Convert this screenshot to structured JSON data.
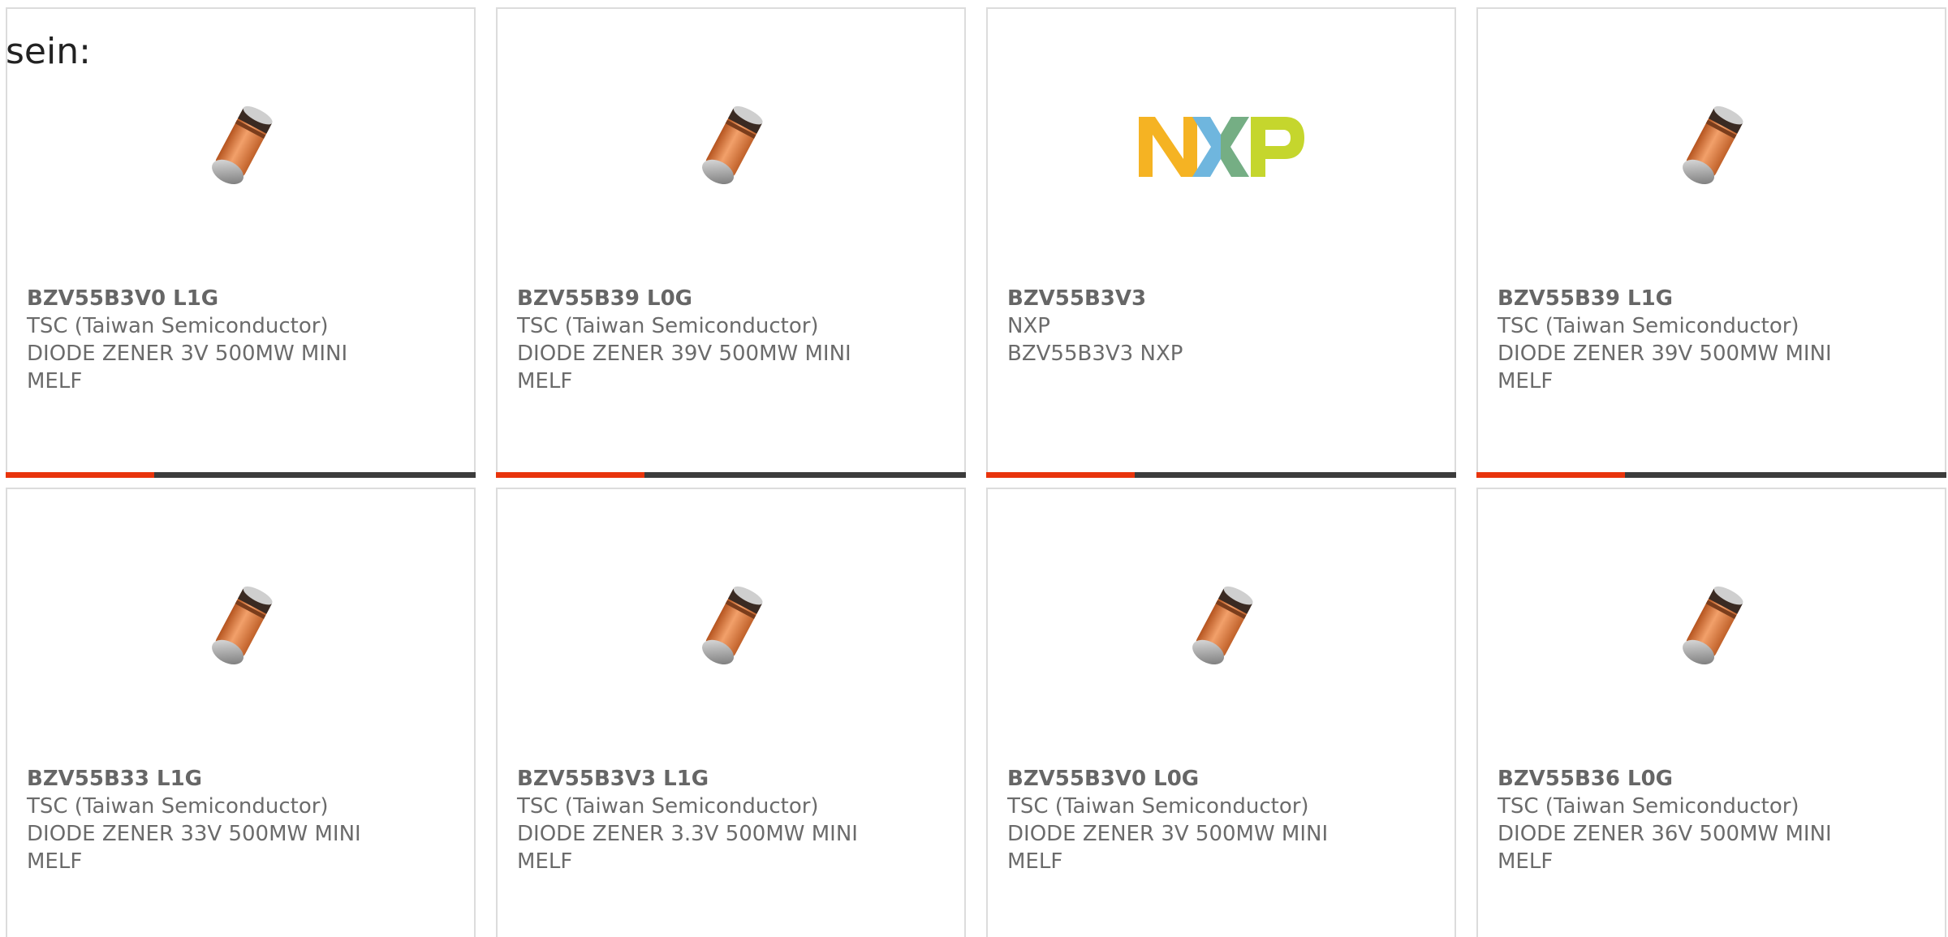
{
  "heading": "sein:",
  "accent_color": "#e8340c",
  "bar_color": "#3c3c3c",
  "cards": [
    {
      "part": "BZV55B3V0 L1G",
      "manufacturer": "TSC (Taiwan Semiconductor)",
      "description": "DIODE ZENER 3V 500MW MINI MELF",
      "image": "diode-image"
    },
    {
      "part": "BZV55B39 L0G",
      "manufacturer": "TSC (Taiwan Semiconductor)",
      "description": "DIODE ZENER 39V 500MW MINI MELF",
      "image": "diode-image"
    },
    {
      "part": "BZV55B3V3",
      "manufacturer": "NXP",
      "description": "BZV55B3V3 NXP",
      "image": "nxp-logo"
    },
    {
      "part": "BZV55B39 L1G",
      "manufacturer": "TSC (Taiwan Semiconductor)",
      "description": "DIODE ZENER 39V 500MW MINI MELF",
      "image": "diode-image"
    },
    {
      "part": "BZV55B33 L1G",
      "manufacturer": "TSC (Taiwan Semiconductor)",
      "description": "DIODE ZENER 33V 500MW MINI MELF",
      "image": "diode-image"
    },
    {
      "part": "BZV55B3V3 L1G",
      "manufacturer": "TSC (Taiwan Semiconductor)",
      "description": "DIODE ZENER 3.3V 500MW MINI MELF",
      "image": "diode-image"
    },
    {
      "part": "BZV55B3V0 L0G",
      "manufacturer": "TSC (Taiwan Semiconductor)",
      "description": "DIODE ZENER 3V 500MW MINI MELF",
      "image": "diode-image"
    },
    {
      "part": "BZV55B36 L0G",
      "manufacturer": "TSC (Taiwan Semiconductor)",
      "description": "DIODE ZENER 36V 500MW MINI MELF",
      "image": "diode-image"
    }
  ]
}
